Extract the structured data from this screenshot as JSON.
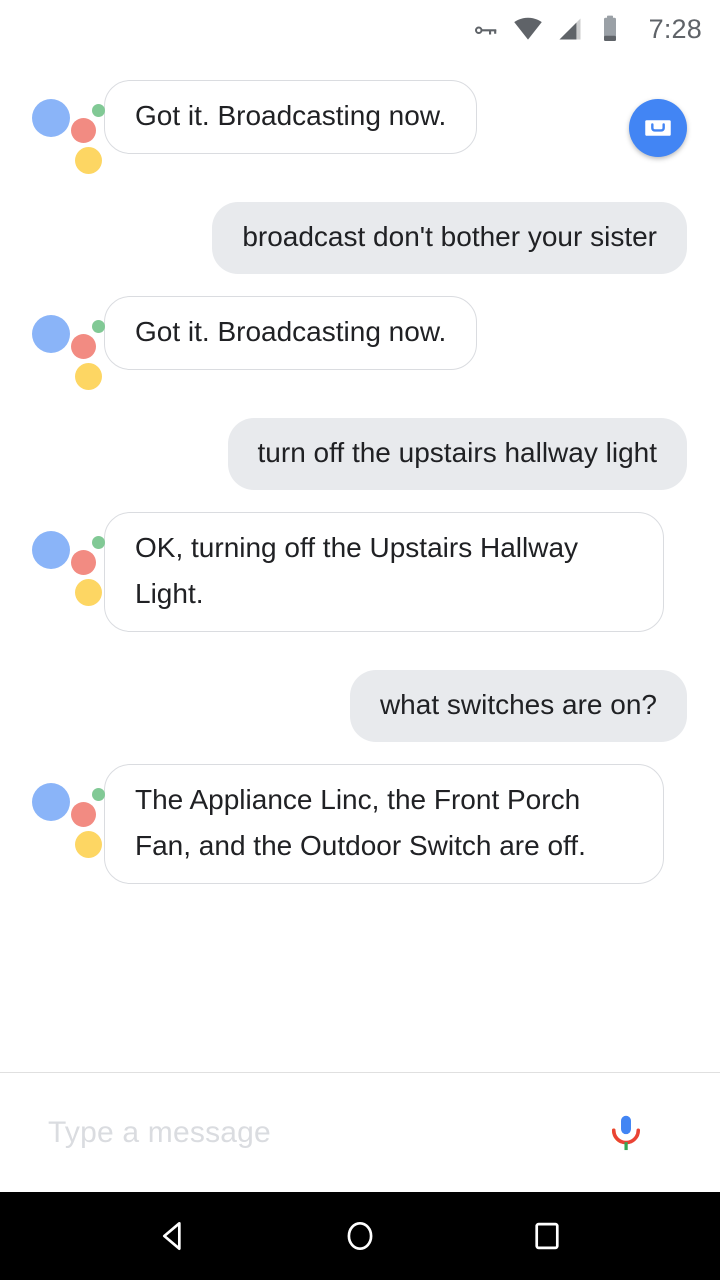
{
  "status_bar": {
    "icons": [
      "vpn-key-icon",
      "wifi-icon",
      "cellular-signal-icon",
      "battery-icon"
    ],
    "time": "7:28"
  },
  "conversation": {
    "messages": [
      {
        "sender": "assistant",
        "text": "Got it. Broadcasting now.",
        "has_action_button": true,
        "action_button": "broadcast-button"
      },
      {
        "sender": "user",
        "text": "broadcast don't bother your sister",
        "has_action_button": false
      },
      {
        "sender": "assistant",
        "text": "Got it. Broadcasting now.",
        "has_action_button": false
      },
      {
        "sender": "user",
        "text": "turn off the upstairs hallway light",
        "has_action_button": false
      },
      {
        "sender": "assistant",
        "text": "OK, turning off the Upstairs Hallway Light.",
        "has_action_button": false
      },
      {
        "sender": "user",
        "text": "what switches are on?",
        "has_action_button": false
      },
      {
        "sender": "assistant",
        "text": "The Appliance Linc, the Front Porch Fan, and the Outdoor Switch are off.",
        "has_action_button": false
      }
    ]
  },
  "input_bar": {
    "placeholder": "Type a message",
    "value": "",
    "mic_icon": "google-microphone-icon"
  },
  "nav_bar": {
    "back": "back-icon",
    "home": "home-icon",
    "recents": "recents-icon"
  },
  "colors": {
    "assistant_bubble_bg": "#ffffff",
    "assistant_bubble_border": "#dadce0",
    "user_bubble_bg": "#e8eaed",
    "text": "#202124",
    "accent_blue": "#4285f4",
    "placeholder": "#dadce0",
    "nav_bar_bg": "#000000",
    "logo_blue": "#8ab4f8",
    "logo_red": "#f28b82",
    "logo_yellow": "#fdd663",
    "logo_green": "#81c995"
  }
}
